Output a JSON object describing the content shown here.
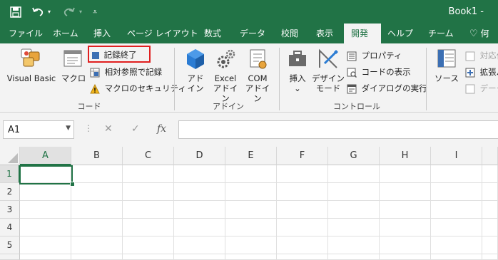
{
  "titlebar": {
    "title": "Book1 -"
  },
  "tabs": [
    "ファイル",
    "ホーム",
    "挿入",
    "ページ レイアウト",
    "数式",
    "データ",
    "校閲",
    "表示",
    "開発",
    "ヘルプ",
    "チーム",
    "何"
  ],
  "ribbon": {
    "code": {
      "visual_basic": "Visual Basic",
      "macro": "マクロ",
      "stop_recording": "記録終了",
      "relative_ref": "相対参照で記録",
      "macro_security": "マクロのセキュリティ",
      "label": "コード"
    },
    "addins": {
      "addin_line1": "アド",
      "addin_line2": "イン",
      "excel_line1": "Excel",
      "excel_line2": "アドイン",
      "com_line1": "COM",
      "com_line2": "アドイン",
      "label": "アドイン"
    },
    "controls": {
      "insert": "挿入",
      "insert_arrow": "⌄",
      "design_line1": "デザイン",
      "design_line2": "モード",
      "properties": "プロパティ",
      "view_code": "コードの表示",
      "run_dialog": "ダイアログの実行",
      "label": "コントロール"
    },
    "xml": {
      "source": "ソース",
      "map_props": "対応付",
      "expansion": "拡張パ",
      "data": "データ"
    }
  },
  "formula_bar": {
    "name_box": "A1",
    "fx": "fx",
    "value": ""
  },
  "columns": [
    "A",
    "B",
    "C",
    "D",
    "E",
    "F",
    "G",
    "H",
    "I"
  ],
  "rows": [
    "1",
    "2",
    "3",
    "4",
    "5"
  ]
}
